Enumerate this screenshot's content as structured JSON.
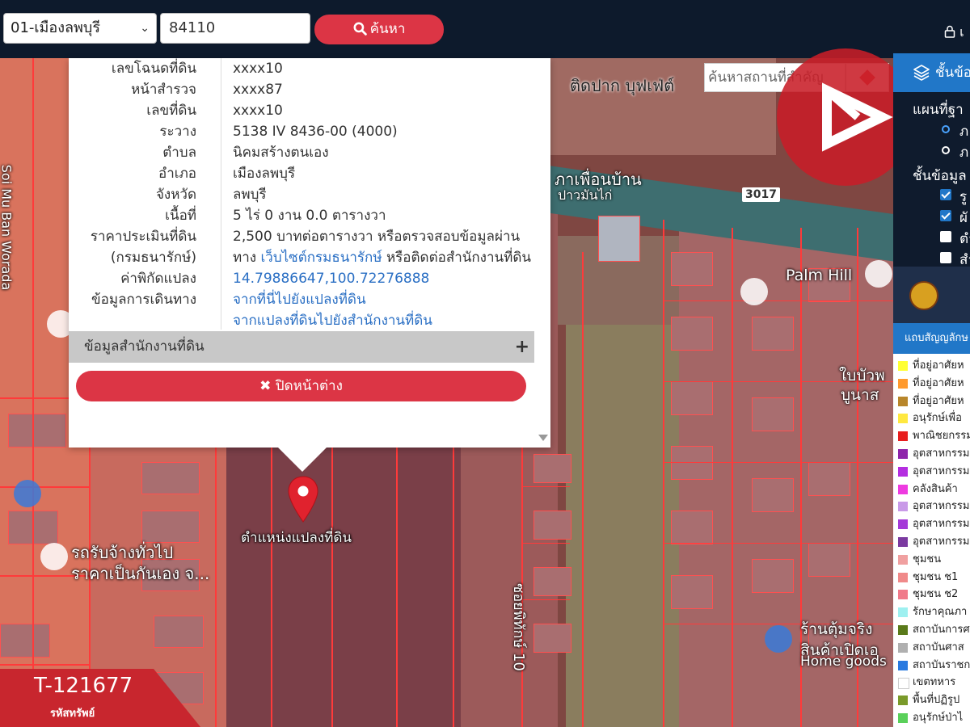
{
  "topbar": {
    "district_select": "01-เมืองลพบุรี",
    "zip_value": "84110",
    "search_label": "ค้นหา",
    "login_label": "เ"
  },
  "map": {
    "search_placeholder": "ค้นหาสถานที่สำคัญ",
    "labels": {
      "restaurant": "ติดปาก บุฟเฟ่ต์",
      "road_name": "ภาเพื่อนบ้าน",
      "road_sub": "ปาวมันไก่",
      "road_number": "3017",
      "palm_hill": "Palm Hill",
      "soi": "Soi Mu Ban Worada",
      "car_rental_1": "รถรับจ้างทั่วไป",
      "car_rental_2": "ราคาเป็นกันเอง จ...",
      "soi_vertical": "ซอยพิทักษ์ 10",
      "store_1": "ร้านตุ้มจริง",
      "store_2": "สินค้าเปิดเอ",
      "store_3": "Home goods",
      "right_label_1": "ใบบัวพ",
      "right_label_2": "บูนาส"
    },
    "pin_label": "ตำแหน่งแปลงที่ดิน"
  },
  "popup": {
    "rows": [
      {
        "label": "เลขโฉนดที่ดิน",
        "value": "xxxx10"
      },
      {
        "label": "หน้าสำรวจ",
        "value": "xxxx87"
      },
      {
        "label": "เลขที่ดิน",
        "value": "xxxx10"
      },
      {
        "label": "ระวาง",
        "value": "5138 IV 8436-00 (4000)"
      },
      {
        "label": "ตำบล",
        "value": "นิคมสร้างตนเอง"
      },
      {
        "label": "อำเภอ",
        "value": "เมืองลพบุรี"
      },
      {
        "label": "จังหวัด",
        "value": "ลพบุรี"
      },
      {
        "label": "เนื้อที่",
        "value": "5 ไร่ 0 งาน 0.0 ตารางวา"
      }
    ],
    "price_label_1": "ราคาประเมินที่ดิน",
    "price_label_2": "(กรมธนารักษ์)",
    "price_value_1": "2,500 บาทต่อตารางวา หรือตรวจสอบข้อมูลผ่าน",
    "price_value_2_pre": "ทาง ",
    "price_value_2_link": "เว็บไซต์กรมธนารักษ์",
    "price_value_2_post": " หรือติดต่อสำนักงานที่ดิน",
    "coord_label": "ค่าพิกัดแปลง",
    "coord_value": "14.79886647,100.72276888",
    "travel_label": "ข้อมูลการเดินทาง",
    "travel_link_1": "จากที่นี่ไปยังแปลงที่ดิน",
    "travel_link_2": "จากแปลงที่ดินไปยังสำนักงานที่ดิน",
    "section_title": "ข้อมูลสำนักงานที่ดิน",
    "close_label": "ปิดหน้าต่าง"
  },
  "panel": {
    "title": "ชั้นข้อ",
    "basemap_title": "แผนที่ฐา",
    "basemap_opt_1": "ภ",
    "basemap_opt_2": "ภ",
    "layers_title": "ชั้นข้อมูล",
    "layer_1": "รู",
    "layer_2": "ผั",
    "layer_3": "ตำ",
    "layer_4": "สำ",
    "legend_title": "แถบสัญญลักษ",
    "legend": [
      {
        "label": "ที่อยู่อาศัยห",
        "color": "#ffff33"
      },
      {
        "label": "ที่อยู่อาศัยห",
        "color": "#ff9a2e"
      },
      {
        "label": "ที่อยู่อาศัยห",
        "color": "#b8862b"
      },
      {
        "label": "อนุรักษ์เพื่อ",
        "color": "#ffe840"
      },
      {
        "label": "พาณิชยกรรม",
        "color": "#e81e1e"
      },
      {
        "label": "อุตสาหกรรม",
        "color": "#8e24aa"
      },
      {
        "label": "อุตสาหกรรม",
        "color": "#b42ee0"
      },
      {
        "label": "คลังสินค้า",
        "color": "#ee3be0"
      },
      {
        "label": "อุตสาหกรรม",
        "color": "#c99ae8"
      },
      {
        "label": "อุตสาหกรรม",
        "color": "#a53ad8"
      },
      {
        "label": "อุตสาหกรรม",
        "color": "#7b3aa0"
      },
      {
        "label": "ชุมชน",
        "color": "#f0a0a0"
      },
      {
        "label": "ชุมชน  ช1",
        "color": "#f08a8a"
      },
      {
        "label": "ชุมชน  ช2",
        "color": "#f07a8a"
      },
      {
        "label": "รักษาคุณภา",
        "color": "#9ef0f0"
      },
      {
        "label": "สถาบันการศ",
        "color": "#5a7a1a"
      },
      {
        "label": "สถาบันศาส",
        "color": "#b0b0b0"
      },
      {
        "label": "สถาบันราชก",
        "color": "#2a7ae0"
      },
      {
        "label": "เขตทหาร",
        "color": "#ffffff"
      },
      {
        "label": "พื้นที่ปฏิรูป",
        "color": "#7a9a2a"
      },
      {
        "label": "อนุรักษ์ป่าไ",
        "color": "#5ad05a"
      }
    ]
  },
  "property_code": {
    "code": "T-121677",
    "caption": "รหัสทรัพย์"
  }
}
